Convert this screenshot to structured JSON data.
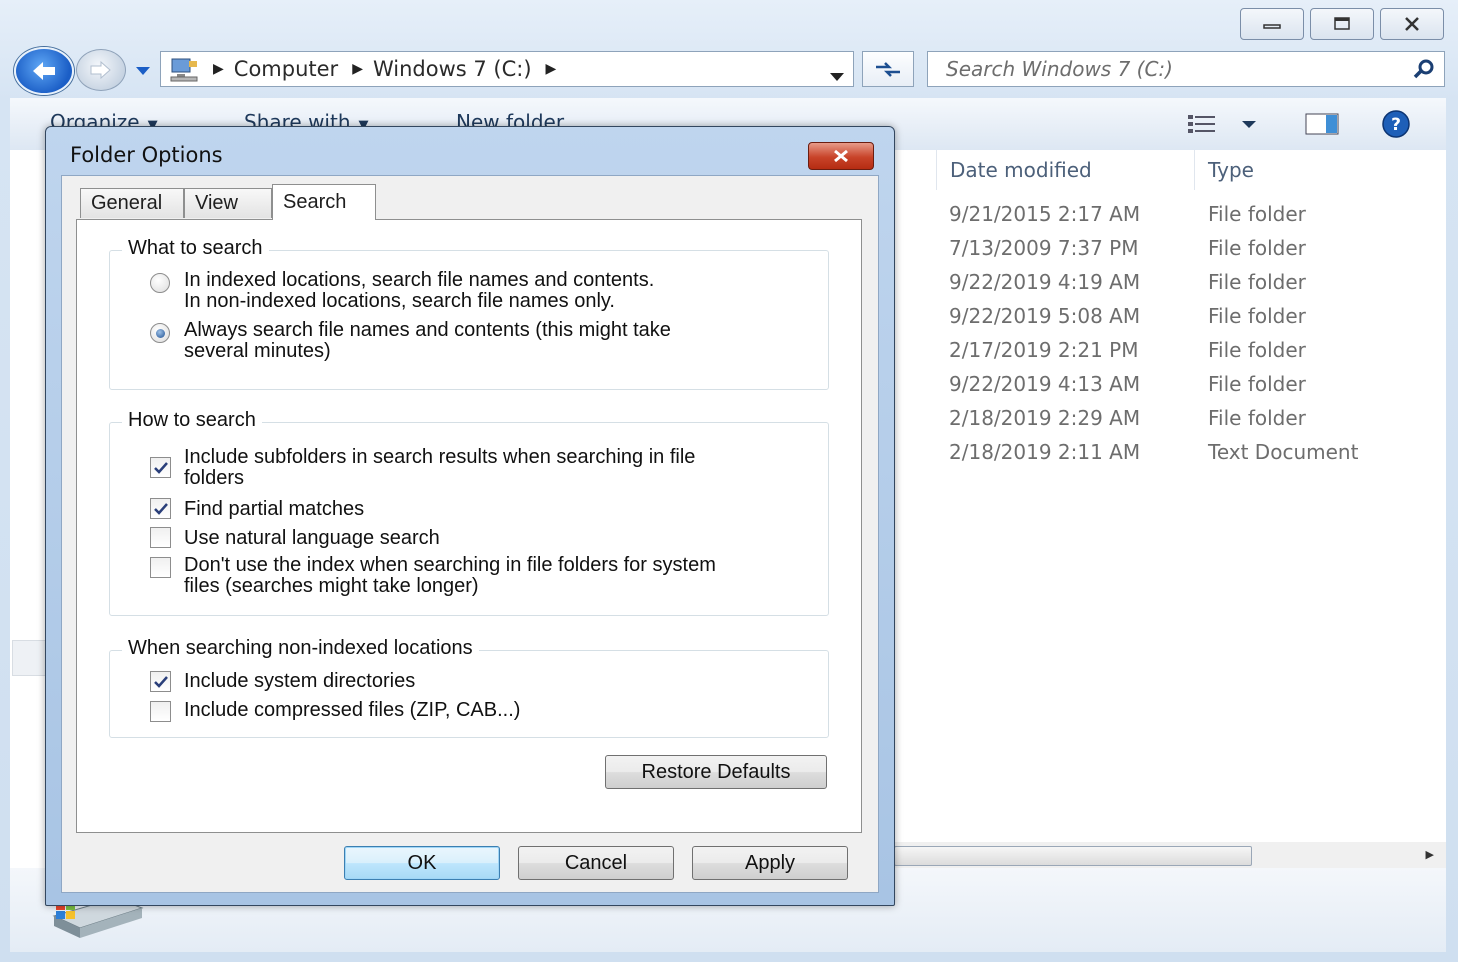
{
  "explorer": {
    "breadcrumb": [
      "Computer",
      "Windows 7 (C:)"
    ],
    "search_placeholder": "Search Windows 7 (C:)",
    "commands": {
      "organize": "Organize",
      "share_with": "Share with",
      "new_folder": "New folder"
    },
    "columns": {
      "date_modified": "Date modified",
      "type": "Type"
    },
    "rows": [
      {
        "date": "9/21/2015 2:17 AM",
        "type": "File folder"
      },
      {
        "date": "7/13/2009 7:37 PM",
        "type": "File folder"
      },
      {
        "date": "9/22/2019 4:19 AM",
        "type": "File folder"
      },
      {
        "date": "9/22/2019 5:08 AM",
        "type": "File folder"
      },
      {
        "date": "2/17/2019 2:21 PM",
        "type": "File folder"
      },
      {
        "date": "9/22/2019 4:13 AM",
        "type": "File folder"
      },
      {
        "date": "2/18/2019 2:29 AM",
        "type": "File folder"
      },
      {
        "date": "2/18/2019 2:11 AM",
        "type": "Text Document"
      }
    ]
  },
  "dialog": {
    "title": "Folder Options",
    "tabs": [
      "General",
      "View",
      "Search"
    ],
    "active_tab": "Search",
    "what_to_search": {
      "title": "What to search",
      "options": [
        {
          "line1": "In indexed locations, search file names and contents.",
          "line2": "In non-indexed locations, search file names only.",
          "selected": false
        },
        {
          "line1": "Always search file names and contents (this might take",
          "line2": "several minutes)",
          "selected": true
        }
      ]
    },
    "how_to_search": {
      "title": "How to search",
      "options": [
        {
          "line1": "Include subfolders in search results when searching in file",
          "line2": "folders",
          "checked": true
        },
        {
          "line1": "Find partial matches",
          "line2": "",
          "checked": true
        },
        {
          "line1": "Use natural language search",
          "line2": "",
          "checked": false
        },
        {
          "line1": "Don't use the index when searching in file folders for system",
          "line2": "files (searches might take longer)",
          "checked": false
        }
      ]
    },
    "non_indexed": {
      "title": "When searching non-indexed locations",
      "options": [
        {
          "label": "Include system directories",
          "checked": true
        },
        {
          "label": "Include compressed files (ZIP, CAB...)",
          "checked": false
        }
      ]
    },
    "buttons": {
      "restore_defaults": "Restore Defaults",
      "ok": "OK",
      "cancel": "Cancel",
      "apply": "Apply"
    }
  },
  "icons": {
    "minimize": "minimize-icon",
    "maximize": "maximize-icon",
    "close": "close-icon",
    "back": "back-arrow-icon",
    "forward": "forward-arrow-icon",
    "refresh": "refresh-icon",
    "search": "search-icon",
    "help": "help-icon",
    "preview_pane": "preview-pane-icon",
    "view_options": "view-options-icon",
    "drive": "drive-icon"
  },
  "colors": {
    "accent": "#1b5ec6",
    "close_red": "#c84329",
    "command_text": "#1e395b"
  }
}
